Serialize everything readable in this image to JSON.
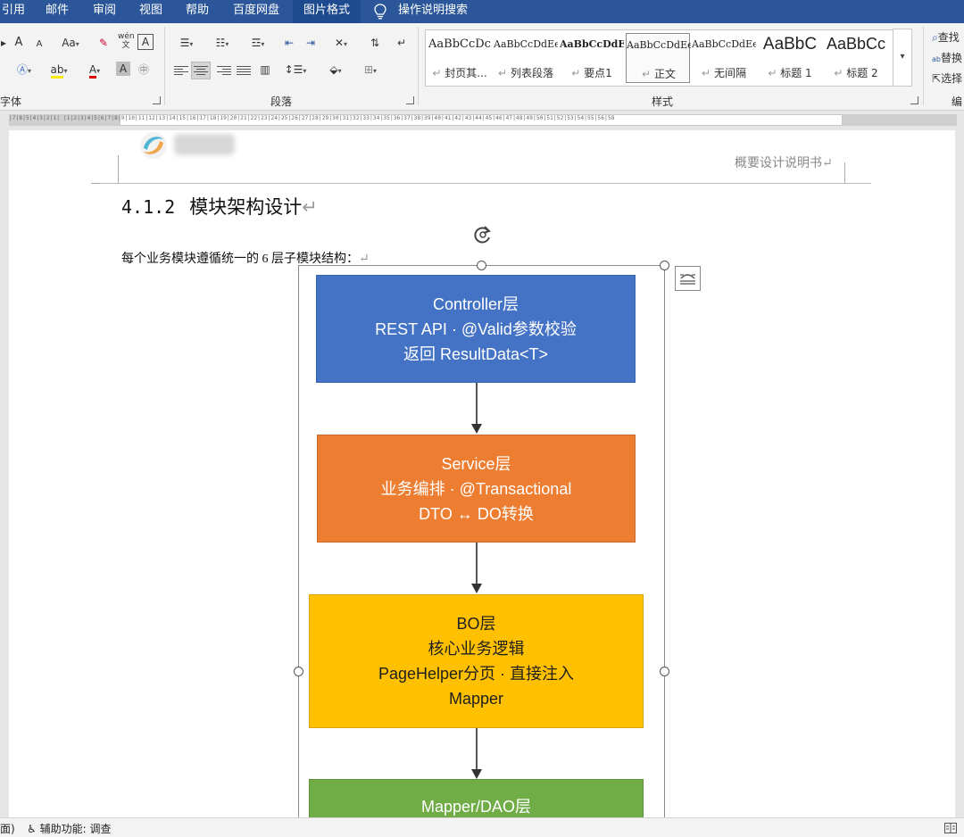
{
  "para_mark": "↵",
  "menu": {
    "items": [
      "引用",
      "邮件",
      "审阅",
      "视图",
      "帮助",
      "百度网盘",
      "图片格式",
      "操作说明搜索"
    ],
    "active_index": 6
  },
  "ribbon": {
    "font_group_label": "字体",
    "paragraph_group_label": "段落",
    "styles_group_label": "样式",
    "edit_group_label": "编",
    "font_controls": [
      "A",
      "A",
      "Aa",
      "A",
      "A"
    ],
    "styles": [
      {
        "preview": "AaBbCcDc",
        "name": "封页其..."
      },
      {
        "preview": "AaBbCcDdEe",
        "name": "列表段落"
      },
      {
        "preview": "AaBbCcDdEe",
        "name": "要点1"
      },
      {
        "preview": "AaBbCcDdEe",
        "name": "正文"
      },
      {
        "preview": "AaBbCcDdEe",
        "name": "无间隔"
      },
      {
        "preview": "AaBbC",
        "name": "标题 1"
      },
      {
        "preview": "AaBbCc",
        "name": "标题 2"
      }
    ],
    "selected_style_index": 3,
    "edit_actions": [
      "查找",
      "替换",
      "选择"
    ]
  },
  "document": {
    "header_text": "概要设计说明书",
    "heading_number": "4.1.2",
    "heading_title": "模块架构设计",
    "paragraph": "每个业务模块遵循统一的 6 层子模块结构："
  },
  "diagram": {
    "blocks": [
      {
        "lines": [
          "Controller层",
          "REST API · @Valid参数校验",
          "返回 ResultData<T>"
        ],
        "color": "#4472c4"
      },
      {
        "lines": [
          "Service层",
          "业务编排 · @Transactional",
          "DTO ↔ DO转换"
        ],
        "color": "#ed7d31"
      },
      {
        "lines": [
          "BO层",
          "核心业务逻辑",
          "PageHelper分页 · 直接注入",
          "Mapper"
        ],
        "color": "#ffc000"
      },
      {
        "lines": [
          "Mapper/DAO层"
        ],
        "color": "#70ad47"
      }
    ]
  },
  "statusbar": {
    "left_fragment": "面)",
    "accessibility": "辅助功能: 调查"
  }
}
